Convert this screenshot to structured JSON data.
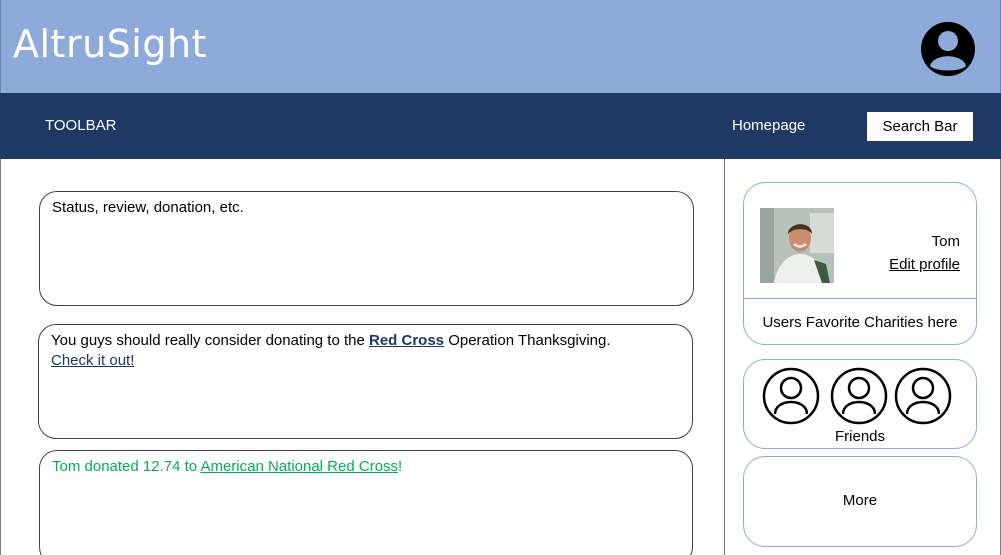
{
  "header": {
    "app_title": "AltruSight",
    "avatar_icon": "user-avatar-icon"
  },
  "toolbar": {
    "label": "TOOLBAR",
    "homepage_link": "Homepage",
    "search_label": "Search Bar"
  },
  "feed": {
    "status_placeholder": "Status, review, donation, etc.",
    "posts": [
      {
        "text_before": "You guys should really consider donating to the ",
        "link_text": "Red Cross",
        "text_after": " Operation Thanksgiving.",
        "cta_link": "Check it out!"
      },
      {
        "text_before": "Tom donated 12.74 to ",
        "link_text": "American National Red Cross",
        "text_after": "!"
      }
    ]
  },
  "sidebar": {
    "profile": {
      "name": "Tom",
      "edit_link": "Edit profile",
      "favorites_label": "Users Favorite Charities here"
    },
    "friends": {
      "label": "Friends",
      "icons": [
        "friend-icon",
        "friend-icon",
        "friend-icon"
      ]
    },
    "more_label": "More"
  },
  "colors": {
    "header_bg": "#8eaadb",
    "toolbar_bg": "#203864",
    "link_dark": "#1f3864",
    "donation_green": "#00b050",
    "card_border": "#8eaadb"
  }
}
